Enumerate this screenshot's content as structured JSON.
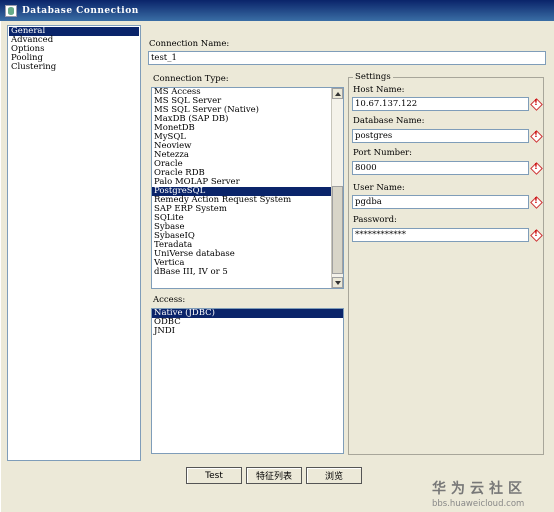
{
  "window": {
    "title": "Database Connection"
  },
  "nav": {
    "items": [
      {
        "label": "General",
        "selected": true
      },
      {
        "label": "Advanced",
        "selected": false
      },
      {
        "label": "Options",
        "selected": false
      },
      {
        "label": "Pooling",
        "selected": false
      },
      {
        "label": "Clustering",
        "selected": false
      }
    ]
  },
  "connection_name": {
    "label": "Connection Name:",
    "value": "test_1"
  },
  "connection_type": {
    "label": "Connection Type:",
    "items": [
      "MS Access",
      "MS SQL Server",
      "MS SQL Server (Native)",
      "MaxDB (SAP DB)",
      "MonetDB",
      "MySQL",
      "Neoview",
      "Netezza",
      "Oracle",
      "Oracle RDB",
      "Palo MOLAP Server",
      "PostgreSQL",
      "Remedy Action Request System",
      "SAP ERP System",
      "SQLite",
      "Sybase",
      "SybaseIQ",
      "Teradata",
      "UniVerse database",
      "Vertica",
      "dBase III, IV or 5"
    ],
    "selected": "PostgreSQL"
  },
  "access": {
    "label": "Access:",
    "items": [
      "Native (JDBC)",
      "ODBC",
      "JNDI"
    ],
    "selected": "Native (JDBC)"
  },
  "settings": {
    "legend": "Settings",
    "host_name": {
      "label": "Host Name:",
      "value": "10.67.137.122"
    },
    "database_name": {
      "label": "Database Name:",
      "value": "postgres"
    },
    "port_number": {
      "label": "Port Number:",
      "value": "8000"
    },
    "user_name": {
      "label": "User Name:",
      "value": "pgdba"
    },
    "password": {
      "label": "Password:",
      "value": "************"
    }
  },
  "buttons": {
    "test": "Test",
    "feature_list": "特征列表",
    "explore": "浏览"
  },
  "watermark": {
    "title": "华为云社区",
    "url": "bbs.huaweicloud.com"
  }
}
